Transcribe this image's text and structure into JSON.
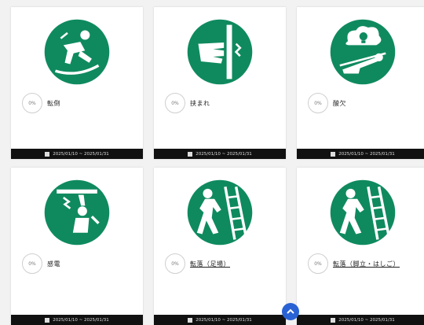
{
  "colors": {
    "icon_green": "#0f8a5f",
    "footer_bg": "#111111",
    "scroll_button": "#2962d4"
  },
  "cards": [
    {
      "icon": "slip-fall-icon",
      "badge": "0%",
      "title": "転倒",
      "date_range": "2025/01/10 ~ 2025/01/31"
    },
    {
      "icon": "hand-caught-icon",
      "badge": "0%",
      "title": "挟まれ",
      "date_range": "2025/01/10 ~ 2025/01/31"
    },
    {
      "icon": "hazard-collapse-icon",
      "badge": "0%",
      "title": "酸欠",
      "date_range": "2025/01/10 ~ 2025/01/31"
    },
    {
      "icon": "electric-shock-icon",
      "badge": "0%",
      "title": "感電",
      "date_range": "2025/01/10 ~ 2025/01/31"
    },
    {
      "icon": "ladder-fall-icon",
      "badge": "0%",
      "title": "転落（足場）",
      "date_range": "2025/01/10 ~ 2025/01/31"
    },
    {
      "icon": "ladder-fall-icon",
      "badge": "0%",
      "title": "転落（脚立・はしご）",
      "date_range": "2025/01/10 ~ 2025/01/31"
    }
  ],
  "scroll_top": {
    "icon": "chevron-up-icon"
  }
}
